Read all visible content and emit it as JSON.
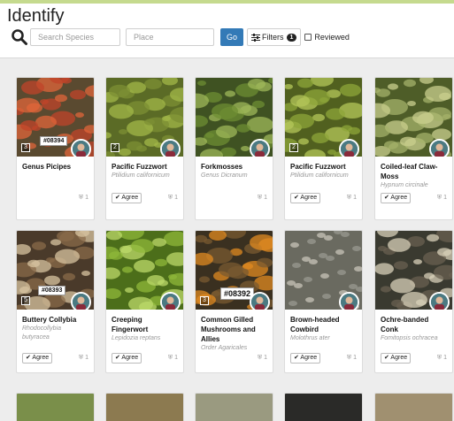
{
  "page": {
    "title": "Identify"
  },
  "search": {
    "species_placeholder": "Search Species",
    "place_placeholder": "Place",
    "go_label": "Go",
    "filters_label": "Filters",
    "filters_count": "1",
    "reviewed_label": "Reviewed"
  },
  "labels": {
    "agree": "✔ Agree",
    "ids_icon": "identification-icon"
  },
  "colors": {
    "brand_green": "#c5da8e",
    "go_blue": "#337ab7"
  },
  "observations": [
    {
      "common": "Genus Picipes",
      "sci": "",
      "count": "3",
      "ids": "1",
      "agree": false
    },
    {
      "common": "Pacific Fuzzwort",
      "sci": "Ptilidium californicum",
      "count": "2",
      "ids": "1",
      "agree": true
    },
    {
      "common": "Forkmosses",
      "sci": "Genus Dicranum",
      "count": "",
      "ids": "1",
      "agree": false
    },
    {
      "common": "Pacific Fuzzwort",
      "sci": "Ptilidium californicum",
      "count": "2",
      "ids": "1",
      "agree": true
    },
    {
      "common": "Coiled-leaf Claw-Moss",
      "sci": "Hypnum circinale",
      "count": "",
      "ids": "1",
      "agree": true
    },
    {
      "common": "Buttery Collybia",
      "sci": "Rhodocollybia butyracea",
      "count": "5",
      "ids": "1",
      "agree": true
    },
    {
      "common": "Creeping Fingerwort",
      "sci": "Lepidozia reptans",
      "count": "",
      "ids": "1",
      "agree": true
    },
    {
      "common": "Common Gilled Mushrooms and Allies",
      "sci": "Order Agaricales",
      "count": "3",
      "ids": "1",
      "agree": false
    },
    {
      "common": "Brown-headed Cowbird",
      "sci": "Molothrus ater",
      "count": "",
      "ids": "1",
      "agree": true
    },
    {
      "common": "Ochre-banded Conk",
      "sci": "Fomitopsis ochracea",
      "count": "",
      "ids": "1",
      "agree": true
    }
  ],
  "photo_tags": {
    "card0": "#08394",
    "card5": "#08393",
    "card7": "#08392"
  }
}
